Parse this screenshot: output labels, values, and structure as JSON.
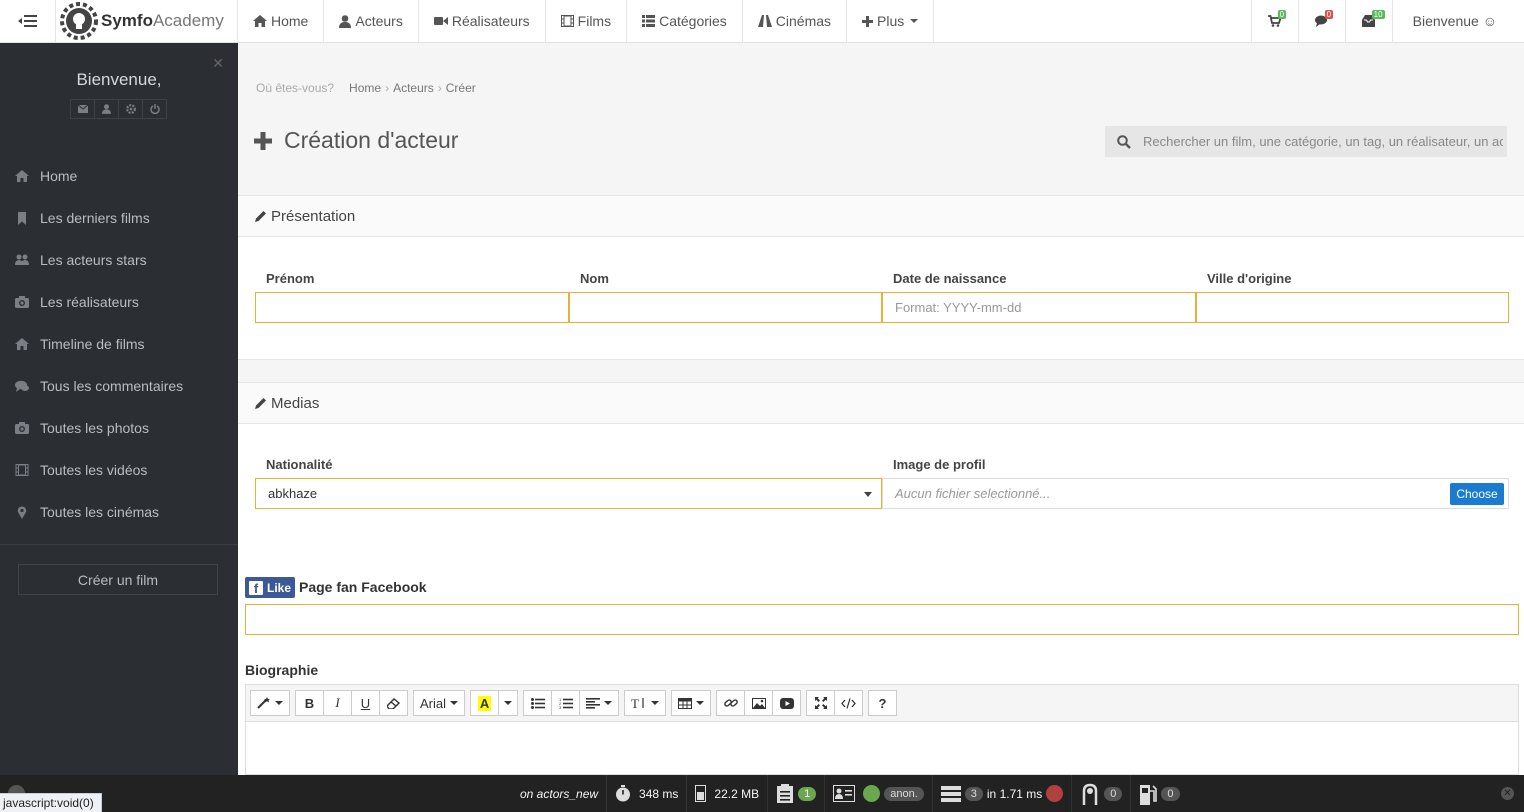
{
  "topbar": {
    "brand_bold": "Symfo",
    "brand_light": "Academy",
    "nav": [
      {
        "label": "Home",
        "icon": "home-icon"
      },
      {
        "label": "Acteurs",
        "icon": "user-icon"
      },
      {
        "label": "Réalisateurs",
        "icon": "video-camera-icon"
      },
      {
        "label": "Films",
        "icon": "film-icon"
      },
      {
        "label": "Catégories",
        "icon": "list-icon"
      },
      {
        "label": "Cinémas",
        "icon": "road-icon"
      },
      {
        "label": "Plus",
        "icon": "plus-icon"
      }
    ],
    "cart_count": "0",
    "comments_count": "0",
    "messages_count": "10",
    "user_label": "Bienvenue ☺"
  },
  "sidebar": {
    "welcome": "Bienvenue,",
    "items": [
      {
        "label": "Home",
        "icon": "home-icon"
      },
      {
        "label": "Les derniers films",
        "icon": "bookmark-icon"
      },
      {
        "label": "Les acteurs stars",
        "icon": "users-icon"
      },
      {
        "label": "Les réalisateurs",
        "icon": "camera-icon"
      },
      {
        "label": "Timeline de films",
        "icon": "home-icon"
      },
      {
        "label": "Tous les commentaires",
        "icon": "comments-icon"
      },
      {
        "label": "Toutes les photos",
        "icon": "camera-icon"
      },
      {
        "label": "Toutes les vidéos",
        "icon": "film-icon"
      },
      {
        "label": "Toutes les cinémas",
        "icon": "map-marker-icon"
      }
    ],
    "create_button": "Créer un film"
  },
  "breadcrumb": {
    "label": "Où êtes-vous?",
    "items": [
      "Home",
      "Acteurs",
      "Créer"
    ]
  },
  "page": {
    "title": "Création d'acteur",
    "search_placeholder": "Rechercher un film, une catégorie, un tag, un réalisateur, un acteur"
  },
  "presentation": {
    "title": "Présentation",
    "fields": {
      "prenom": {
        "label": "Prénom",
        "value": ""
      },
      "nom": {
        "label": "Nom",
        "value": ""
      },
      "date": {
        "label": "Date de naissance",
        "placeholder": "Format: YYYY-mm-dd"
      },
      "ville": {
        "label": "Ville d'origine",
        "value": ""
      }
    }
  },
  "medias": {
    "title": "Medias",
    "nationalite": {
      "label": "Nationalité",
      "value": "abkhaze"
    },
    "image": {
      "label": "Image de profil",
      "placeholder": "Aucun fichier selectionné...",
      "button": "Choose"
    }
  },
  "facebook": {
    "like": "Like",
    "label": "Page fan Facebook"
  },
  "biographie": {
    "label": "Biographie",
    "toolbar_font": "Arial",
    "toolbar_color": "A",
    "toolbar_bold": "B",
    "toolbar_italic": "I",
    "toolbar_underline": "U",
    "toolbar_help": "?"
  },
  "sf_toolbar": {
    "route": "on actors_new",
    "time": "348 ms",
    "memory": "22.2 MB",
    "forms": "1",
    "user": "anon.",
    "queries": "3",
    "query_time": "in 1.71 ms",
    "twig": "0",
    "assets": "0"
  },
  "status_url": "javascript:void(0)",
  "colors": {
    "accent_border": "#e3b339",
    "sidebar_bg": "#2b2e33",
    "choose_button": "#1a7bd0",
    "facebook": "#3b5998"
  }
}
